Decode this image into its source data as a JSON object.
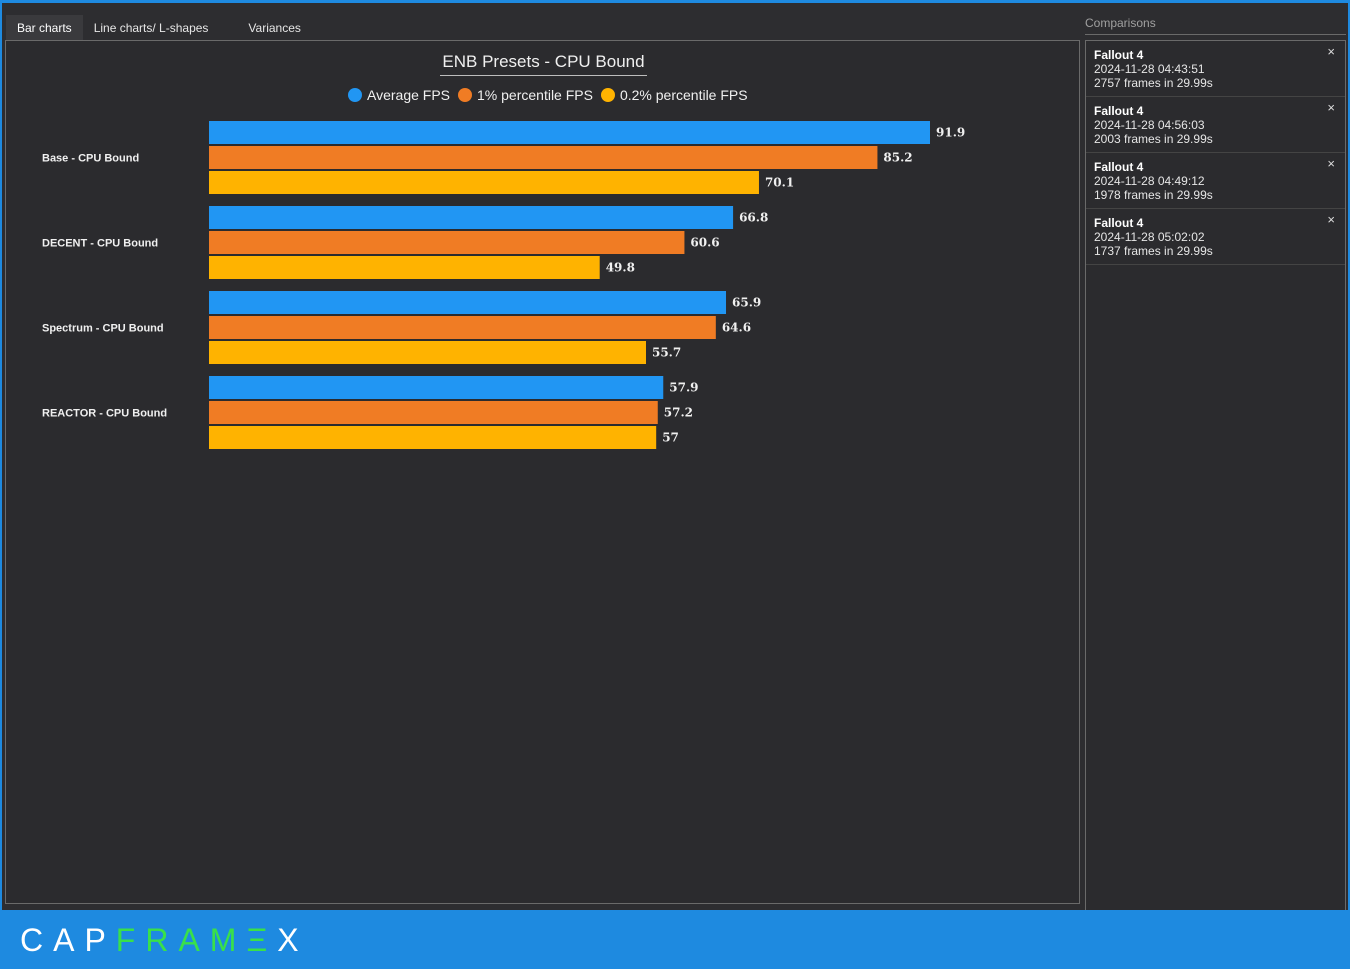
{
  "tabs": [
    {
      "label": "Bar charts"
    },
    {
      "label": "Line charts/ L-shapes"
    },
    {
      "label": "Variances"
    }
  ],
  "chart_data": {
    "type": "bar",
    "orientation": "horizontal",
    "title": "ENB Presets - CPU Bound",
    "categories": [
      "Base - CPU Bound",
      "DECENT - CPU Bound",
      "Spectrum - CPU Bound",
      "REACTOR - CPU Bound"
    ],
    "series": [
      {
        "name": "Average FPS",
        "color": "#2196f3",
        "values": [
          91.9,
          66.8,
          65.9,
          57.9
        ],
        "labels": [
          "91.9",
          "66.8",
          "65.9",
          "57.9"
        ]
      },
      {
        "name": "1% percentile FPS",
        "color": "#f07c24",
        "values": [
          85.2,
          60.6,
          64.6,
          57.2
        ],
        "labels": [
          "85.2",
          "60.6",
          "64.6",
          "57.2"
        ]
      },
      {
        "name": "0.2% percentile FPS",
        "color": "#ffb300",
        "values": [
          70.1,
          49.8,
          55.7,
          57
        ],
        "labels": [
          "70.1",
          "49.8",
          "55.7",
          "57"
        ]
      }
    ],
    "legend": "top-center",
    "grid": false
  },
  "comparisons": {
    "title": "Comparisons",
    "items": [
      {
        "game": "Fallout 4",
        "date": "2024-11-28 04:43:51",
        "frames": "2757 frames in 29.99s"
      },
      {
        "game": "Fallout 4",
        "date": "2024-11-28 04:56:03",
        "frames": "2003 frames in 29.99s"
      },
      {
        "game": "Fallout 4",
        "date": "2024-11-28 04:49:12",
        "frames": "1978 frames in 29.99s"
      },
      {
        "game": "Fallout 4",
        "date": "2024-11-28 05:02:02",
        "frames": "1737 frames in 29.99s"
      }
    ],
    "close_glyph": "×"
  },
  "logo": {
    "letters": [
      {
        "ch": "C",
        "color": "white"
      },
      {
        "ch": "A",
        "color": "white"
      },
      {
        "ch": "P",
        "color": "white"
      },
      {
        "ch": "F",
        "color": "green"
      },
      {
        "ch": "R",
        "color": "green"
      },
      {
        "ch": "A",
        "color": "green"
      },
      {
        "ch": "M",
        "color": "green"
      },
      {
        "ch": "Ξ",
        "color": "green"
      },
      {
        "ch": "X",
        "color": "white"
      }
    ]
  }
}
